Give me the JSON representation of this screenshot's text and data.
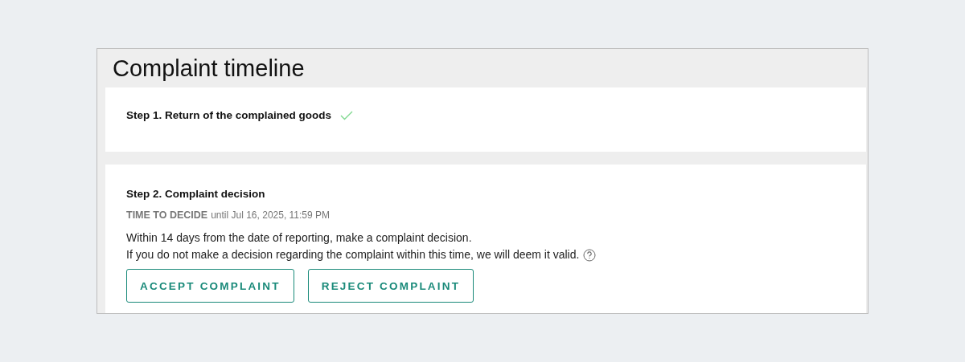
{
  "title": "Complaint timeline",
  "steps": [
    {
      "kind": "simple",
      "title": "Step 1. Return of the complained goods",
      "completed": true
    },
    {
      "kind": "decision",
      "title": "Step 2. Complaint decision",
      "completed": false,
      "deadline_label": "TIME TO DECIDE",
      "deadline": "until Jul 16, 2025, 11:59 PM",
      "description": [
        "Within 14 days from the date of reporting, make a complaint decision.",
        "If you do not make a decision regarding the complaint within this time, we will deem it valid."
      ],
      "buttons": [
        "ACCEPT COMPLAINT",
        "REJECT COMPLAINT"
      ]
    }
  ]
}
